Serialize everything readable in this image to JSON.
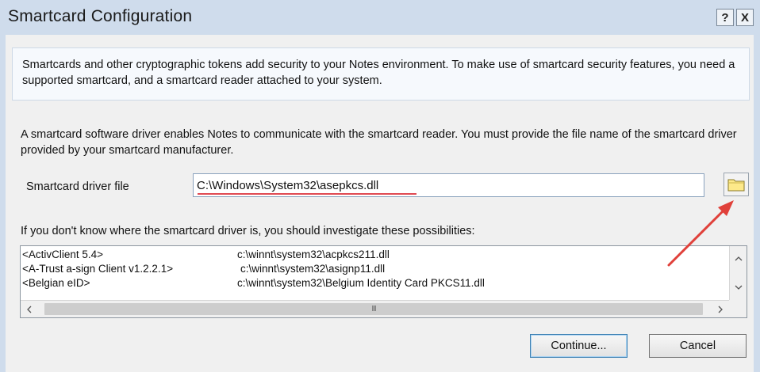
{
  "window": {
    "title": "Smartcard Configuration",
    "help_label": "?",
    "close_label": "X"
  },
  "info": {
    "text": "Smartcards and other cryptographic tokens add security to your Notes environment. To make use of smartcard security features, you need a supported smartcard, and a smartcard reader attached to your system."
  },
  "driver": {
    "description": "A smartcard software driver enables Notes to communicate with the smartcard reader.  You must provide the file name of the smartcard driver provided by your smartcard manufacturer.",
    "label": "Smartcard driver file",
    "value": "C:\\Windows\\System32\\asepkcs.dll",
    "browse_icon": "folder-icon"
  },
  "possibilities": {
    "label": "If you don't know where the smartcard driver is, you should investigate these possibilities:",
    "items": [
      {
        "name": "<ActivClient 5.4>",
        "path": "c:\\winnt\\system32\\acpkcs211.dll"
      },
      {
        "name": "<A-Trust a-sign Client v1.2.2.1>",
        "path": "c:\\winnt\\system32\\asignp11.dll"
      },
      {
        "name": "<Belgian eID>",
        "path": "c:\\winnt\\system32\\Belgium Identity Card PKCS11.dll"
      }
    ],
    "scroll_up": "^",
    "scroll_down": "v",
    "scroll_left": "<",
    "scroll_right": ">",
    "thumb_grip": "III"
  },
  "buttons": {
    "continue": "Continue...",
    "cancel": "Cancel"
  },
  "colors": {
    "annotation_arrow": "#e0403a",
    "underline": "#e04a52",
    "titlebar": "#cfdcec"
  }
}
